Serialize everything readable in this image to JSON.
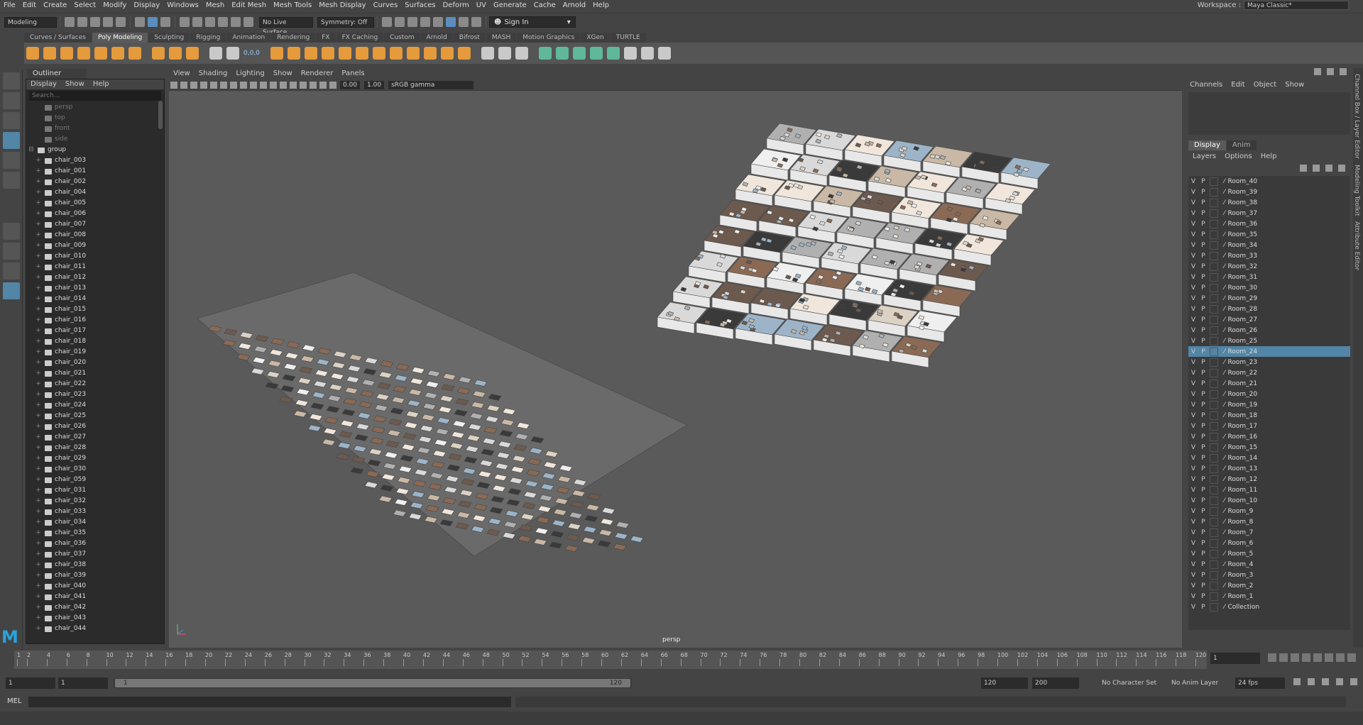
{
  "menubar": {
    "items": [
      "File",
      "Edit",
      "Create",
      "Select",
      "Modify",
      "Display",
      "Windows",
      "Mesh",
      "Edit Mesh",
      "Mesh Tools",
      "Mesh Display",
      "Curves",
      "Surfaces",
      "Deform",
      "UV",
      "Generate",
      "Cache",
      "Arnold",
      "Help"
    ],
    "workspace_label": "Workspace :",
    "workspace_value": "Maya Classic*"
  },
  "statusline": {
    "mode": "Modeling",
    "live_surface": "No Live Surface",
    "symmetry": "Symmetry: Off",
    "sign_in": "Sign In"
  },
  "shelf": {
    "tabs": [
      "Curves / Surfaces",
      "Poly Modeling",
      "Sculpting",
      "Rigging",
      "Animation",
      "Rendering",
      "FX",
      "FX Caching",
      "Custom",
      "Arnold",
      "Bifrost",
      "MASH",
      "Motion Graphics",
      "XGen",
      "TURTLE"
    ],
    "active": "Poly Modeling",
    "xyz_label": "0,0,0"
  },
  "outliner": {
    "tab": "Outliner",
    "menu": [
      "Display",
      "Show",
      "Help"
    ],
    "search_placeholder": "Search...",
    "cameras": [
      "persp",
      "top",
      "front",
      "side"
    ],
    "group": "group",
    "items": [
      "chair_003",
      "chair_001",
      "chair_002",
      "chair_004",
      "chair_005",
      "chair_006",
      "chair_007",
      "chair_008",
      "chair_009",
      "chair_010",
      "chair_011",
      "chair_012",
      "chair_013",
      "chair_014",
      "chair_015",
      "chair_016",
      "chair_017",
      "chair_018",
      "chair_019",
      "chair_020",
      "chair_021",
      "chair_022",
      "chair_023",
      "chair_024",
      "chair_025",
      "chair_026",
      "chair_027",
      "chair_028",
      "chair_029",
      "chair_030",
      "chair_059",
      "chair_031",
      "chair_032",
      "chair_033",
      "chair_034",
      "chair_035",
      "chair_036",
      "chair_037",
      "chair_038",
      "chair_039",
      "chair_040",
      "chair_041",
      "chair_042",
      "chair_043",
      "chair_044"
    ]
  },
  "viewport": {
    "menu": [
      "View",
      "Shading",
      "Lighting",
      "Show",
      "Renderer",
      "Panels"
    ],
    "exposure": "0.00",
    "gamma": "1.00",
    "color_space": "sRGB gamma",
    "camera_label": "persp"
  },
  "channelbox": {
    "menu": [
      "Channels",
      "Edit",
      "Object",
      "Show"
    ]
  },
  "layer_editor": {
    "tabs": [
      "Display",
      "Anim"
    ],
    "active": "Display",
    "menu": [
      "Layers",
      "Options",
      "Help"
    ],
    "layers": [
      "Room_40",
      "Room_39",
      "Room_38",
      "Room_37",
      "Room_36",
      "Room_35",
      "Room_34",
      "Room_33",
      "Room_32",
      "Room_31",
      "Room_30",
      "Room_29",
      "Room_28",
      "Room_27",
      "Room_26",
      "Room_25",
      "Room_24",
      "Room_23",
      "Room_22",
      "Room_21",
      "Room_20",
      "Room_19",
      "Room_18",
      "Room_17",
      "Room_16",
      "Room_15",
      "Room_14",
      "Room_13",
      "Room_12",
      "Room_11",
      "Room_10",
      "Room_9",
      "Room_8",
      "Room_7",
      "Room_6",
      "Room_5",
      "Room_4",
      "Room_3",
      "Room_2",
      "Room_1",
      "Collection"
    ],
    "selected": "Room_24",
    "v": "V",
    "p": "P"
  },
  "side_tabs": [
    "Channel Box / Layer Editor",
    "Modeling Toolkit",
    "Attribute Editor"
  ],
  "timeline": {
    "ticks": [
      "1",
      "2",
      "4",
      "6",
      "8",
      "10",
      "12",
      "14",
      "16",
      "18",
      "20",
      "22",
      "24",
      "26",
      "28",
      "30",
      "32",
      "34",
      "36",
      "38",
      "40",
      "42",
      "44",
      "46",
      "48",
      "50",
      "52",
      "54",
      "56",
      "58",
      "60",
      "62",
      "64",
      "66",
      "68",
      "70",
      "72",
      "74",
      "76",
      "78",
      "80",
      "82",
      "84",
      "86",
      "88",
      "90",
      "92",
      "94",
      "96",
      "98",
      "100",
      "102",
      "104",
      "106",
      "108",
      "110",
      "112",
      "114",
      "116",
      "118",
      "120"
    ],
    "current_frame": "1"
  },
  "range": {
    "start": "1",
    "start2": "1",
    "range_start": "1",
    "range_end": "120",
    "end": "120",
    "end2": "200",
    "character_set": "No Character Set",
    "anim_layer": "No Anim Layer",
    "fps": "24 fps"
  },
  "cmdline": {
    "label": "MEL"
  }
}
